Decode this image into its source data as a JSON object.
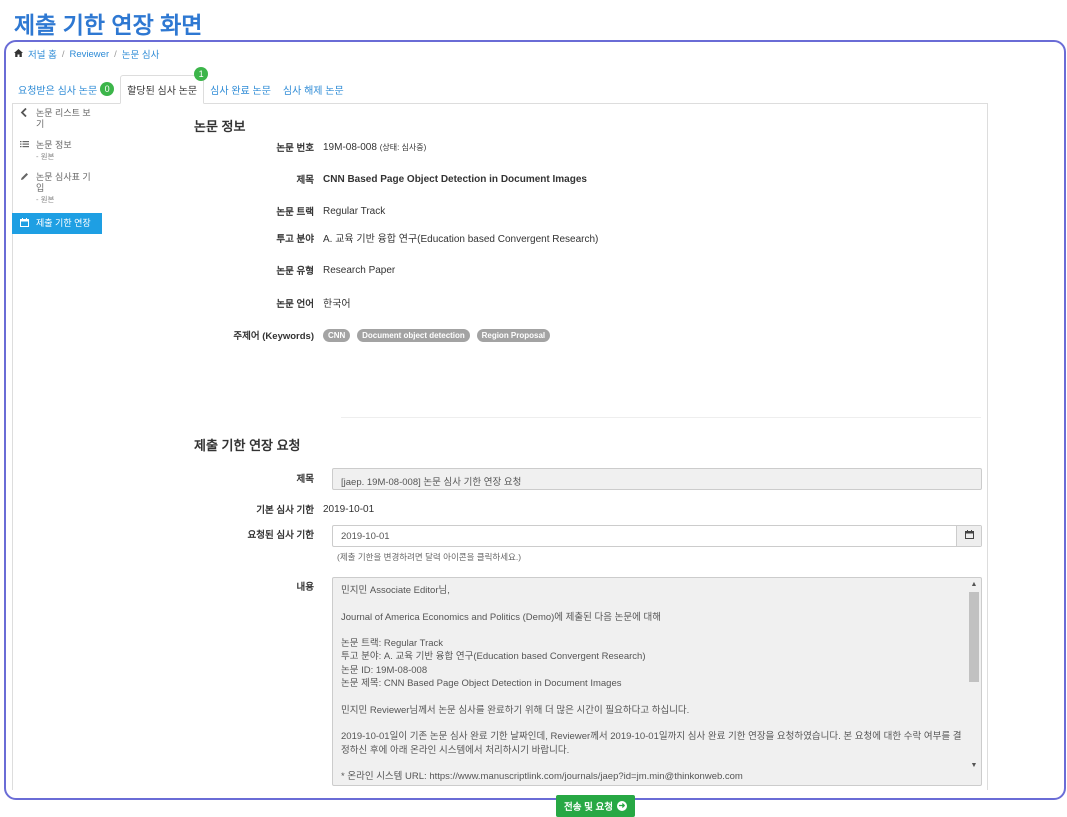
{
  "page_heading": "제출 기한 연장 화면",
  "breadcrumb": {
    "home_icon": "home-icon",
    "items": [
      "저널 홈",
      "Reviewer",
      "논문 심사"
    ],
    "separator": "/"
  },
  "tabs": [
    {
      "label": "요청받은 심사 논문",
      "badge": "0",
      "active": false
    },
    {
      "label": "할당된 심사 논문",
      "badge": "1",
      "active": true
    },
    {
      "label": "심사 완료 논문",
      "active": false
    },
    {
      "label": "심사 해제 논문",
      "active": false
    }
  ],
  "sidebar": {
    "items": [
      {
        "icon": "chevron-left-icon",
        "label": "논문 리스트 보기"
      },
      {
        "icon": "list-icon",
        "label": "논문 정보",
        "sub": "- 원본"
      },
      {
        "icon": "pencil-icon",
        "label": "논문 심사표 기입",
        "sub": "- 원본"
      },
      {
        "icon": "calendar-icon",
        "label": "제출 기한 연장",
        "active": true
      }
    ]
  },
  "paper_info": {
    "title": "논문 정보",
    "number_label": "논문 번호",
    "number_value": "19M-08-008",
    "number_status": "(상태: 심사중)",
    "title_label": "제목",
    "title_value": "CNN Based Page Object Detection in Document Images",
    "track_label": "논문 트랙",
    "track_value": "Regular Track",
    "field_label": "투고 분야",
    "field_value": "A. 교육 기반 융합 연구(Education based Convergent Research)",
    "type_label": "논문 유형",
    "type_value": "Research Paper",
    "lang_label": "논문 언어",
    "lang_value": "한국어",
    "keywords_label": "주제어 (Keywords)",
    "keywords": [
      "CNN",
      "Document object detection",
      "Region Proposal"
    ]
  },
  "extension": {
    "title": "제출 기한 연장 요청",
    "subject_label": "제목",
    "subject_value": "[jaep. 19M-08-008] 논문 심사 기한 연장 요청",
    "base_deadline_label": "기본 심사 기한",
    "base_deadline_value": "2019-10-01",
    "requested_label": "요청된 심사 기한",
    "requested_value": "2019-10-01",
    "requested_help": "(제출 기한을 변경하려면 달력 아이콘을 클릭하세요.)",
    "content_label": "내용",
    "content_lines": [
      "민지민 Associate Editor님,",
      "Journal of America Economics and Politics (Demo)에 제출된 다음 논문에 대해",
      "논문 트랙: Regular Track\n투고 분야: A. 교육 기반 융합 연구(Education based Convergent Research)\n논문 ID: 19M-08-008\n논문 제목: CNN Based Page Object Detection in Document Images",
      "민지민 Reviewer님께서 논문 심사를 완료하기 위해 더 많은 시간이 필요하다고 하십니다.",
      "2019-10-01일이 기존 논문 심사 완료 기한 날짜인데, Reviewer께서 2019-10-01일까지 심사 완료 기한 연장을 요청하였습니다. 본 요청에 대한 수락 여부를 결정하신 후에 아래 온라인 시스템에서 처리하시기 바랍니다.",
      "* 온라인 시스템 URL: https://www.manuscriptlink.com/journals/jaep?id=jm.min@thinkonweb.com"
    ],
    "submit_label": "전송 및 요청"
  }
}
